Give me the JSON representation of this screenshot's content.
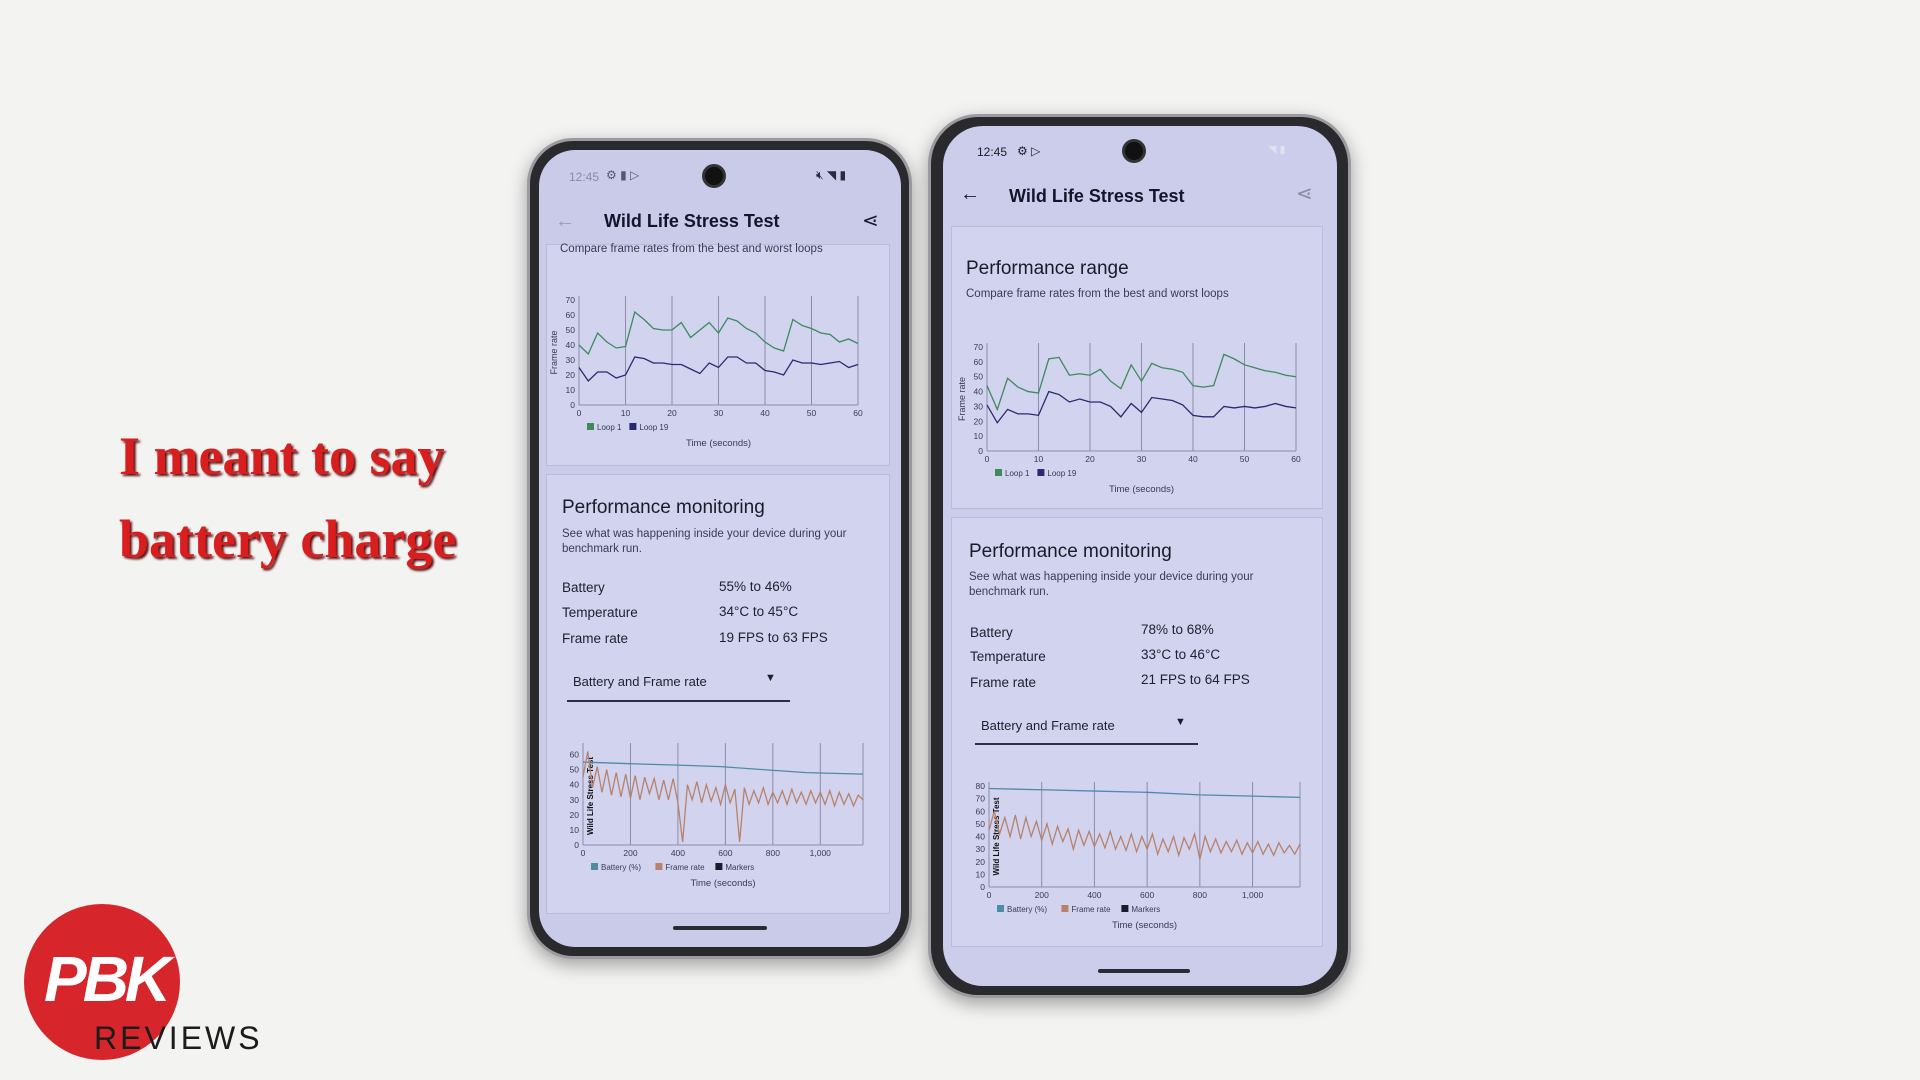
{
  "overlay": {
    "line1": "I meant to say",
    "line2": "battery charge"
  },
  "logo": {
    "mark": "PBK",
    "text": "REVIEWS",
    "color": "#d6262b"
  },
  "colors": {
    "loop1": "#3e8a5c",
    "loop19": "#2a2a70",
    "battery": "#4f8ba3",
    "frame_rate": "#b8826a",
    "markers": "#1b1b2e",
    "screen": "#c9cbe9"
  },
  "phones": [
    {
      "status": {
        "time": "12:45",
        "icons": [
          "gear-icon",
          "flashlight-icon",
          "play-store-icon",
          "mute-icon",
          "wifi-icon",
          "battery-icon"
        ]
      },
      "header": {
        "title": "Wild Life Stress Test",
        "back_icon": "arrow-left-icon",
        "share_icon": "share-icon"
      },
      "range": {
        "title": "",
        "subtitle": "Compare frame rates from the best and worst loops"
      },
      "monitoring": {
        "title": "Performance monitoring",
        "desc": "See what was happening inside your device during your benchmark run.",
        "rows": [
          {
            "label": "Battery",
            "value": "55% to 46%"
          },
          {
            "label": "Temperature",
            "value": "34°C to 45°C"
          },
          {
            "label": "Frame rate",
            "value": "19 FPS to 63 FPS"
          }
        ],
        "dropdown": "Battery and Frame rate"
      }
    },
    {
      "status": {
        "time": "12:45",
        "icons": [
          "gear-icon",
          "play-store-icon",
          "wifi-icon",
          "battery-icon"
        ]
      },
      "header": {
        "title": "Wild Life Stress Test",
        "back_icon": "arrow-left-icon",
        "share_icon": "share-icon"
      },
      "range": {
        "title": "Performance range",
        "subtitle": "Compare frame rates from the best and worst loops"
      },
      "monitoring": {
        "title": "Performance monitoring",
        "desc": "See what was happening inside your device during your benchmark run.",
        "rows": [
          {
            "label": "Battery",
            "value": "78% to 68%"
          },
          {
            "label": "Temperature",
            "value": "33°C to 46°C"
          },
          {
            "label": "Frame rate",
            "value": "21 FPS to 64 FPS"
          }
        ],
        "dropdown": "Battery and Frame rate"
      }
    }
  ],
  "chart_data": [
    {
      "type": "line",
      "ylabel": "Frame rate",
      "xlabel": "Time (seconds)",
      "xlim": [
        0,
        60
      ],
      "ylim": [
        0,
        70
      ],
      "xticks": [
        0,
        10,
        20,
        30,
        40,
        50,
        60
      ],
      "yticks": [
        0,
        10,
        20,
        30,
        40,
        50,
        60,
        70
      ],
      "grid": "vertical",
      "legend": "bottom-left",
      "x_step": 2,
      "series": [
        {
          "name": "Loop 1",
          "color": "#3e8a5c",
          "values": [
            40,
            34,
            48,
            42,
            38,
            39,
            62,
            57,
            51,
            50,
            50,
            55,
            45,
            50,
            55,
            48,
            58,
            56,
            51,
            48,
            42,
            38,
            36,
            57,
            53,
            51,
            48,
            47,
            42,
            44,
            41
          ]
        },
        {
          "name": "Loop 19",
          "color": "#2a2a70",
          "values": [
            25,
            16,
            22,
            22,
            18,
            20,
            32,
            31,
            28,
            28,
            27,
            27,
            24,
            21,
            28,
            25,
            32,
            32,
            28,
            28,
            23,
            22,
            20,
            30,
            28,
            28,
            27,
            28,
            29,
            25,
            27
          ]
        }
      ]
    },
    {
      "type": "line",
      "ylabel": "Wild Life Stress Test",
      "xlabel": "Time (seconds)",
      "xlim": [
        0,
        1180
      ],
      "ylim": [
        0,
        65
      ],
      "xticks": [
        0,
        200,
        400,
        600,
        800,
        1000
      ],
      "xtick_labels": [
        "0",
        "200",
        "400",
        "600",
        "800",
        "1,000"
      ],
      "yticks": [
        0,
        10,
        20,
        30,
        40,
        50,
        60
      ],
      "grid": "vertical",
      "legend": "bottom-left",
      "legend_items": [
        "Battery (%)",
        "Frame rate",
        "Markers"
      ],
      "x_step": 20,
      "series": [
        {
          "name": "Battery (%)",
          "color": "#4f8ba3",
          "points": [
            [
              0,
              55
            ],
            [
              180,
              54
            ],
            [
              400,
              53
            ],
            [
              580,
              52
            ],
            [
              760,
              50
            ],
            [
              940,
              48
            ],
            [
              1180,
              47
            ]
          ]
        },
        {
          "name": "Frame rate",
          "color": "#b8826a",
          "values": [
            45,
            62,
            38,
            52,
            35,
            50,
            33,
            48,
            32,
            47,
            31,
            46,
            30,
            45,
            34,
            44,
            30,
            43,
            30,
            44,
            28,
            2,
            40,
            30,
            42,
            28,
            40,
            29,
            38,
            27,
            40,
            28,
            37,
            2,
            38,
            27,
            36,
            28,
            38,
            27,
            35,
            28,
            36,
            27,
            37,
            28,
            35,
            27,
            36,
            28,
            35,
            27,
            36,
            26,
            35,
            27,
            34,
            26,
            33,
            30
          ]
        }
      ]
    },
    {
      "type": "line",
      "ylabel": "Frame rate",
      "xlabel": "Time (seconds)",
      "xlim": [
        0,
        60
      ],
      "ylim": [
        0,
        70
      ],
      "xticks": [
        0,
        10,
        20,
        30,
        40,
        50,
        60
      ],
      "yticks": [
        0,
        10,
        20,
        30,
        40,
        50,
        60,
        70
      ],
      "grid": "vertical",
      "legend": "bottom-left",
      "x_step": 2,
      "series": [
        {
          "name": "Loop 1",
          "color": "#3e8a5c",
          "values": [
            44,
            28,
            49,
            43,
            40,
            39,
            62,
            63,
            51,
            52,
            51,
            55,
            47,
            42,
            58,
            47,
            59,
            56,
            55,
            53,
            44,
            43,
            44,
            65,
            62,
            58,
            56,
            54,
            53,
            51,
            50
          ]
        },
        {
          "name": "Loop 19",
          "color": "#2a2a70",
          "values": [
            31,
            19,
            28,
            25,
            25,
            24,
            40,
            38,
            33,
            35,
            33,
            33,
            30,
            23,
            32,
            26,
            36,
            35,
            34,
            31,
            24,
            23,
            23,
            30,
            29,
            30,
            29,
            30,
            32,
            30,
            29
          ]
        }
      ]
    },
    {
      "type": "line",
      "ylabel": "Wild Life Stress Test",
      "xlabel": "Time (seconds)",
      "xlim": [
        0,
        1180
      ],
      "ylim": [
        0,
        80
      ],
      "xticks": [
        0,
        200,
        400,
        600,
        800,
        1000
      ],
      "xtick_labels": [
        "0",
        "200",
        "400",
        "600",
        "800",
        "1,000"
      ],
      "yticks": [
        0,
        10,
        20,
        30,
        40,
        50,
        60,
        70,
        80
      ],
      "grid": "vertical",
      "legend": "bottom-left",
      "legend_items": [
        "Battery (%)",
        "Frame rate",
        "Markers"
      ],
      "x_step": 20,
      "series": [
        {
          "name": "Battery (%)",
          "color": "#4f8ba3",
          "points": [
            [
              0,
              78
            ],
            [
              200,
              77
            ],
            [
              400,
              76
            ],
            [
              600,
              75
            ],
            [
              800,
              73
            ],
            [
              1000,
              72
            ],
            [
              1180,
              71
            ]
          ]
        },
        {
          "name": "Frame rate",
          "color": "#b8826a",
          "values": [
            45,
            60,
            42,
            55,
            40,
            57,
            38,
            55,
            40,
            52,
            37,
            50,
            34,
            48,
            36,
            46,
            30,
            45,
            33,
            44,
            32,
            42,
            31,
            44,
            30,
            40,
            29,
            42,
            28,
            40,
            30,
            42,
            26,
            38,
            28,
            40,
            25,
            39,
            30,
            42,
            22,
            40,
            28,
            38,
            27,
            36,
            28,
            37,
            26,
            35,
            27,
            36,
            26,
            34,
            25,
            35,
            27,
            33,
            26,
            34
          ]
        }
      ]
    }
  ]
}
